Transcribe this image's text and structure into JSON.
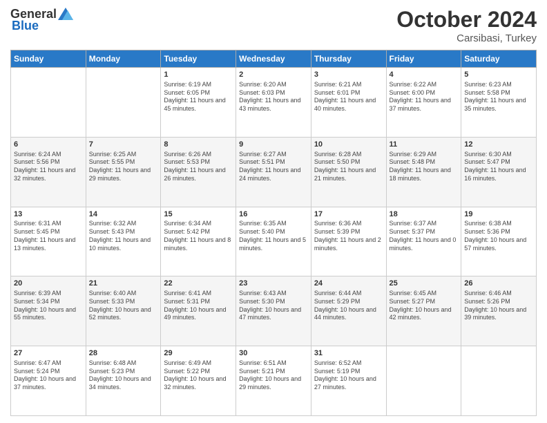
{
  "header": {
    "logo": {
      "general": "General",
      "blue": "Blue"
    },
    "title": "October 2024",
    "location": "Carsibasi, Turkey"
  },
  "days_of_week": [
    "Sunday",
    "Monday",
    "Tuesday",
    "Wednesday",
    "Thursday",
    "Friday",
    "Saturday"
  ],
  "weeks": [
    [
      {
        "day": "",
        "sunrise": "",
        "sunset": "",
        "daylight": ""
      },
      {
        "day": "",
        "sunrise": "",
        "sunset": "",
        "daylight": ""
      },
      {
        "day": "1",
        "sunrise": "Sunrise: 6:19 AM",
        "sunset": "Sunset: 6:05 PM",
        "daylight": "Daylight: 11 hours and 45 minutes."
      },
      {
        "day": "2",
        "sunrise": "Sunrise: 6:20 AM",
        "sunset": "Sunset: 6:03 PM",
        "daylight": "Daylight: 11 hours and 43 minutes."
      },
      {
        "day": "3",
        "sunrise": "Sunrise: 6:21 AM",
        "sunset": "Sunset: 6:01 PM",
        "daylight": "Daylight: 11 hours and 40 minutes."
      },
      {
        "day": "4",
        "sunrise": "Sunrise: 6:22 AM",
        "sunset": "Sunset: 6:00 PM",
        "daylight": "Daylight: 11 hours and 37 minutes."
      },
      {
        "day": "5",
        "sunrise": "Sunrise: 6:23 AM",
        "sunset": "Sunset: 5:58 PM",
        "daylight": "Daylight: 11 hours and 35 minutes."
      }
    ],
    [
      {
        "day": "6",
        "sunrise": "Sunrise: 6:24 AM",
        "sunset": "Sunset: 5:56 PM",
        "daylight": "Daylight: 11 hours and 32 minutes."
      },
      {
        "day": "7",
        "sunrise": "Sunrise: 6:25 AM",
        "sunset": "Sunset: 5:55 PM",
        "daylight": "Daylight: 11 hours and 29 minutes."
      },
      {
        "day": "8",
        "sunrise": "Sunrise: 6:26 AM",
        "sunset": "Sunset: 5:53 PM",
        "daylight": "Daylight: 11 hours and 26 minutes."
      },
      {
        "day": "9",
        "sunrise": "Sunrise: 6:27 AM",
        "sunset": "Sunset: 5:51 PM",
        "daylight": "Daylight: 11 hours and 24 minutes."
      },
      {
        "day": "10",
        "sunrise": "Sunrise: 6:28 AM",
        "sunset": "Sunset: 5:50 PM",
        "daylight": "Daylight: 11 hours and 21 minutes."
      },
      {
        "day": "11",
        "sunrise": "Sunrise: 6:29 AM",
        "sunset": "Sunset: 5:48 PM",
        "daylight": "Daylight: 11 hours and 18 minutes."
      },
      {
        "day": "12",
        "sunrise": "Sunrise: 6:30 AM",
        "sunset": "Sunset: 5:47 PM",
        "daylight": "Daylight: 11 hours and 16 minutes."
      }
    ],
    [
      {
        "day": "13",
        "sunrise": "Sunrise: 6:31 AM",
        "sunset": "Sunset: 5:45 PM",
        "daylight": "Daylight: 11 hours and 13 minutes."
      },
      {
        "day": "14",
        "sunrise": "Sunrise: 6:32 AM",
        "sunset": "Sunset: 5:43 PM",
        "daylight": "Daylight: 11 hours and 10 minutes."
      },
      {
        "day": "15",
        "sunrise": "Sunrise: 6:34 AM",
        "sunset": "Sunset: 5:42 PM",
        "daylight": "Daylight: 11 hours and 8 minutes."
      },
      {
        "day": "16",
        "sunrise": "Sunrise: 6:35 AM",
        "sunset": "Sunset: 5:40 PM",
        "daylight": "Daylight: 11 hours and 5 minutes."
      },
      {
        "day": "17",
        "sunrise": "Sunrise: 6:36 AM",
        "sunset": "Sunset: 5:39 PM",
        "daylight": "Daylight: 11 hours and 2 minutes."
      },
      {
        "day": "18",
        "sunrise": "Sunrise: 6:37 AM",
        "sunset": "Sunset: 5:37 PM",
        "daylight": "Daylight: 11 hours and 0 minutes."
      },
      {
        "day": "19",
        "sunrise": "Sunrise: 6:38 AM",
        "sunset": "Sunset: 5:36 PM",
        "daylight": "Daylight: 10 hours and 57 minutes."
      }
    ],
    [
      {
        "day": "20",
        "sunrise": "Sunrise: 6:39 AM",
        "sunset": "Sunset: 5:34 PM",
        "daylight": "Daylight: 10 hours and 55 minutes."
      },
      {
        "day": "21",
        "sunrise": "Sunrise: 6:40 AM",
        "sunset": "Sunset: 5:33 PM",
        "daylight": "Daylight: 10 hours and 52 minutes."
      },
      {
        "day": "22",
        "sunrise": "Sunrise: 6:41 AM",
        "sunset": "Sunset: 5:31 PM",
        "daylight": "Daylight: 10 hours and 49 minutes."
      },
      {
        "day": "23",
        "sunrise": "Sunrise: 6:43 AM",
        "sunset": "Sunset: 5:30 PM",
        "daylight": "Daylight: 10 hours and 47 minutes."
      },
      {
        "day": "24",
        "sunrise": "Sunrise: 6:44 AM",
        "sunset": "Sunset: 5:29 PM",
        "daylight": "Daylight: 10 hours and 44 minutes."
      },
      {
        "day": "25",
        "sunrise": "Sunrise: 6:45 AM",
        "sunset": "Sunset: 5:27 PM",
        "daylight": "Daylight: 10 hours and 42 minutes."
      },
      {
        "day": "26",
        "sunrise": "Sunrise: 6:46 AM",
        "sunset": "Sunset: 5:26 PM",
        "daylight": "Daylight: 10 hours and 39 minutes."
      }
    ],
    [
      {
        "day": "27",
        "sunrise": "Sunrise: 6:47 AM",
        "sunset": "Sunset: 5:24 PM",
        "daylight": "Daylight: 10 hours and 37 minutes."
      },
      {
        "day": "28",
        "sunrise": "Sunrise: 6:48 AM",
        "sunset": "Sunset: 5:23 PM",
        "daylight": "Daylight: 10 hours and 34 minutes."
      },
      {
        "day": "29",
        "sunrise": "Sunrise: 6:49 AM",
        "sunset": "Sunset: 5:22 PM",
        "daylight": "Daylight: 10 hours and 32 minutes."
      },
      {
        "day": "30",
        "sunrise": "Sunrise: 6:51 AM",
        "sunset": "Sunset: 5:21 PM",
        "daylight": "Daylight: 10 hours and 29 minutes."
      },
      {
        "day": "31",
        "sunrise": "Sunrise: 6:52 AM",
        "sunset": "Sunset: 5:19 PM",
        "daylight": "Daylight: 10 hours and 27 minutes."
      },
      {
        "day": "",
        "sunrise": "",
        "sunset": "",
        "daylight": ""
      },
      {
        "day": "",
        "sunrise": "",
        "sunset": "",
        "daylight": ""
      }
    ]
  ]
}
